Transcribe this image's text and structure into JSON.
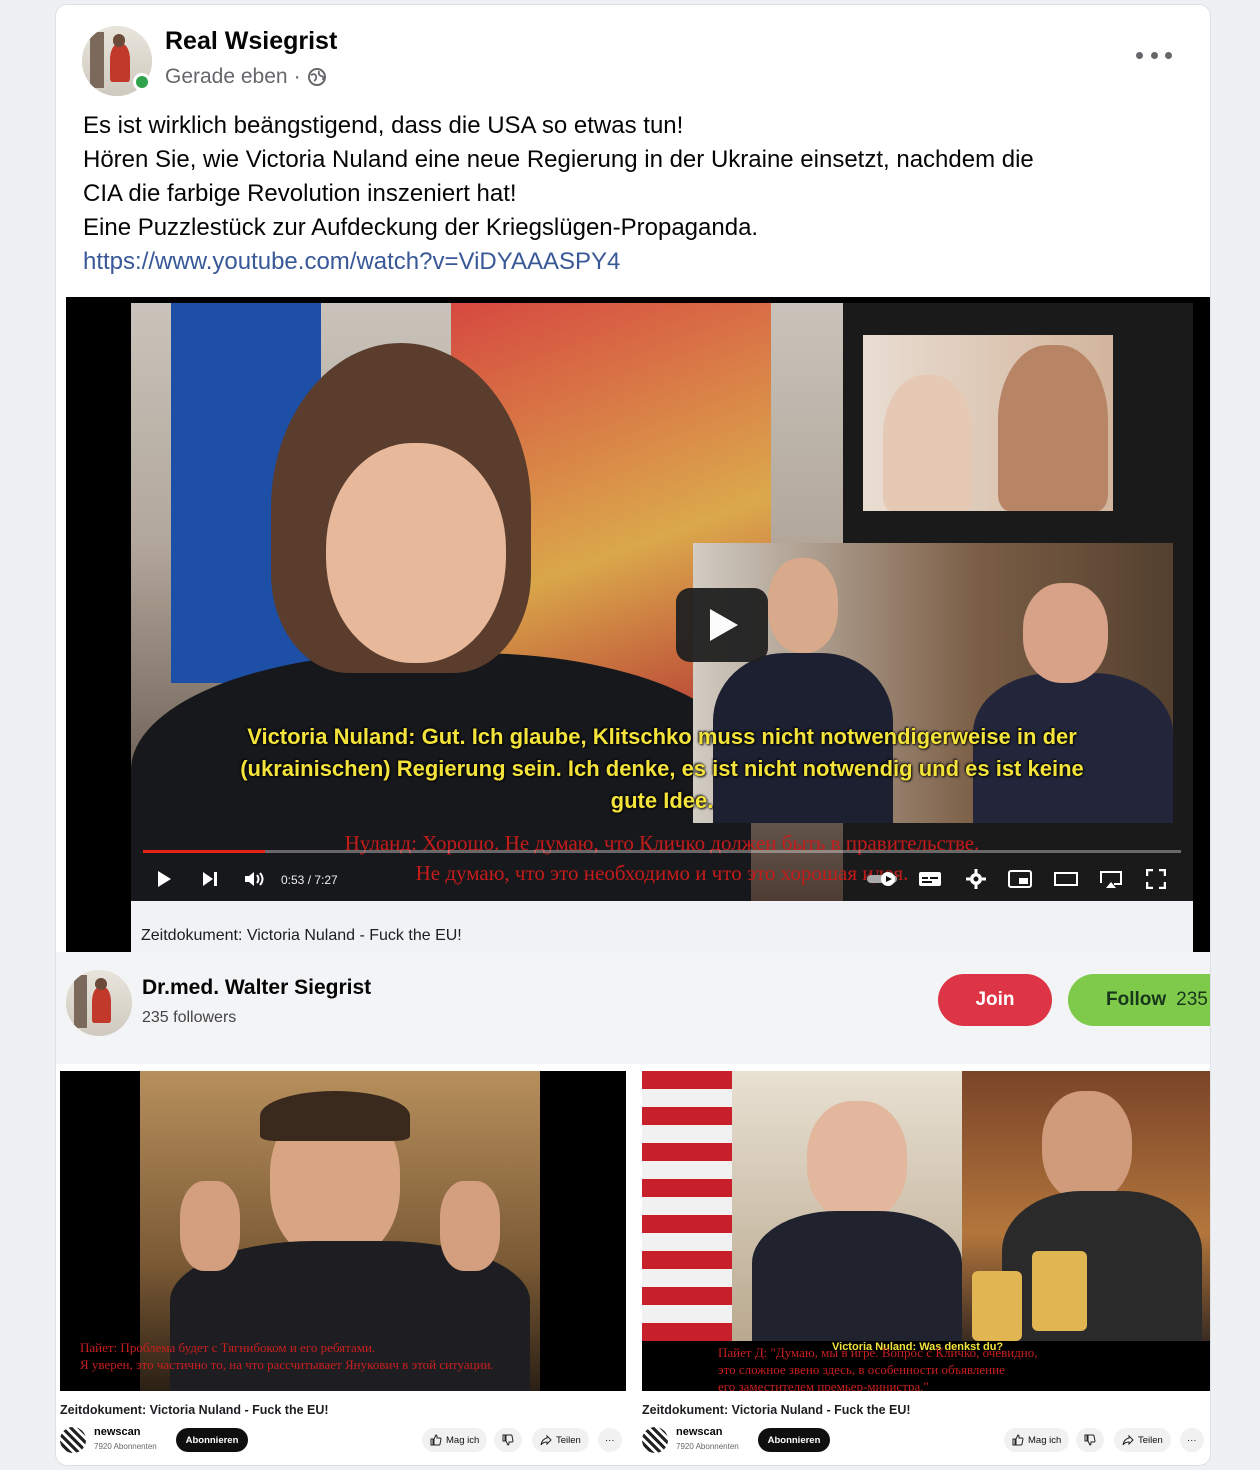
{
  "post": {
    "author": "Real Wsiegrist",
    "timestamp": "Gerade eben",
    "separator": "·",
    "text_lines": [
      "Es ist wirklich beängstigend, dass die USA so etwas tun!",
      "Hören Sie, wie Victoria Nuland eine neue Regierung in der Ukraine einsetzt, nachdem die",
      "CIA die farbige Revolution inszeniert hat!",
      "Eine Puzzlestück zur Aufdeckung der Kriegslügen-Propaganda."
    ],
    "link": "https://www.youtube.com/watch?v=ViDYAAASPY4"
  },
  "video": {
    "subtitle_de": [
      "Victoria Nuland: Gut. Ich glaube, Klitschko muss nicht notwendigerweise in der",
      "(ukrainischen) Regierung sein. Ich denke, es ist nicht notwendig und es ist keine",
      "gute Idee."
    ],
    "subtitle_ru": [
      "Нуланд: Хорошо. Не думаю, что Кличко должен быть в правительстве.",
      "Не думаю, что это необходимо и что это хорошая идея."
    ],
    "time": "0:53 / 7:27",
    "progress": 0.118,
    "caption": "Zeitdokument: Victoria Nuland - Fuck the EU!"
  },
  "channel": {
    "name": "Dr.med. Walter Siegrist",
    "followers": "235 followers",
    "join_label": "Join",
    "follow_label": "Follow",
    "follow_count": "235"
  },
  "thumbnails": [
    {
      "red_text": [
        "Пайет: Проблема будет с Тягнибоком и его ребятами.",
        "Я уверен, это частично то, на что рассчитывает Янукович в этой ситуации."
      ],
      "caption": "Zeitdokument: Victoria Nuland - Fuck the EU!",
      "channel": "newscan",
      "subs": "7920 Abonnenten",
      "subscribe": "Abonnieren",
      "like": "Mag ich",
      "share": "Teilen",
      "more": "···"
    },
    {
      "yellow_text": "Victoria Nuland: Was denkst du?",
      "red_text": [
        "Пайет Д: \"Думаю, мы в игре. Вопрос с Кличко, очевидно,",
        "это сложное звено здесь, в особенности объявление",
        "его заместителем премьер-министра.\""
      ],
      "caption": "Zeitdokument: Victoria Nuland - Fuck the EU!",
      "channel": "newscan",
      "subs": "7920 Abonnenten",
      "subscribe": "Abonnieren",
      "like": "Mag ich",
      "share": "Teilen",
      "more": "···"
    }
  ],
  "colors": {
    "link": "#385898",
    "join": "#dd3545",
    "follow": "#7fca4a",
    "subtitle": "#f3e33a",
    "subtitle_ru": "#c51b1b",
    "online": "#31a24c"
  },
  "icons": [
    "globe-icon",
    "more-icon",
    "play-icon",
    "next-icon",
    "volume-icon",
    "autoplay-toggle-icon",
    "subtitles-icon",
    "settings-icon",
    "miniplayer-icon",
    "theater-icon",
    "cast-icon",
    "fullscreen-icon",
    "like-icon",
    "dislike-icon",
    "share-icon"
  ]
}
